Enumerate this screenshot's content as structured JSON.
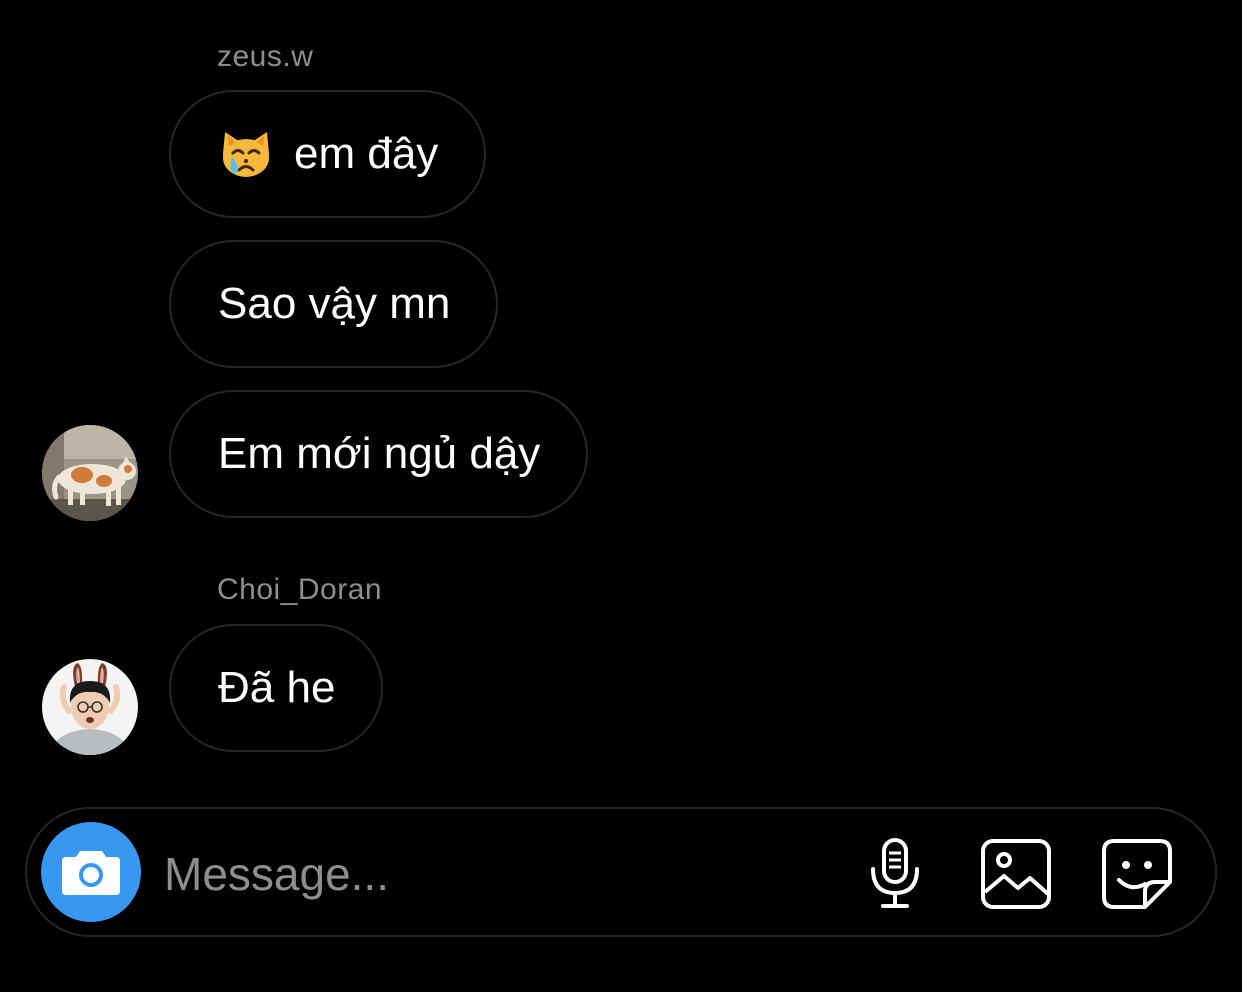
{
  "thread": {
    "groups": [
      {
        "sender": "zeus.w",
        "avatar_icon": "cat-photo-avatar",
        "messages": [
          {
            "emoji_icon": "crying-cat-emoji",
            "text": "em đây"
          },
          {
            "text": "Sao vậy mn"
          },
          {
            "text": "Em mới ngủ dậy"
          }
        ]
      },
      {
        "sender": "Choi_Doran",
        "avatar_icon": "person-bunny-ears-avatar",
        "messages": [
          {
            "text": "Đã he"
          }
        ]
      }
    ]
  },
  "composer": {
    "placeholder": "Message...",
    "value": "",
    "camera_icon": "camera-icon",
    "tools": [
      "microphone-icon",
      "gallery-icon",
      "sticker-icon"
    ]
  },
  "colors": {
    "background": "#000000",
    "bubble_border": "#262626",
    "sender_text": "#8e8e8e",
    "camera_button": "#3897f0",
    "icon": "#ffffff"
  }
}
